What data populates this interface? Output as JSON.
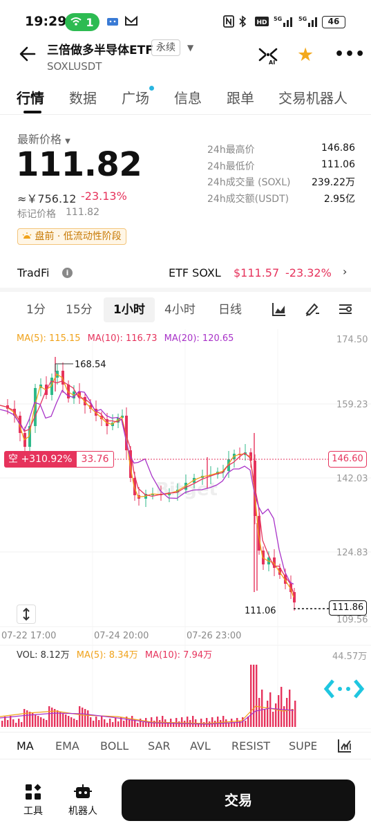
{
  "status_bar": {
    "time": "19:29",
    "wifi_count": "1",
    "network": "5G",
    "battery": "46"
  },
  "header": {
    "title": "三倍做多半导体ETF",
    "badge": "永续",
    "symbol": "SOXLUSDT",
    "ai_label": "AI"
  },
  "main_tabs": [
    {
      "label": "行情"
    },
    {
      "label": "数据"
    },
    {
      "label": "广场"
    },
    {
      "label": "信息"
    },
    {
      "label": "跟单"
    },
    {
      "label": "交易机器人"
    }
  ],
  "price": {
    "label": "最新价格",
    "last": "111.82",
    "cny": "≈￥756.12",
    "change_pct": "-23.13%",
    "mark_label": "标记价格",
    "mark_value": "111.82",
    "stage_badge": "盘前 · 低流动性阶段"
  },
  "stats": [
    {
      "key": "24h最高价",
      "value": "146.86"
    },
    {
      "key": "24h最低价",
      "value": "111.06"
    },
    {
      "key": "24h成交量 (SOXL)",
      "value": "239.22万"
    },
    {
      "key": "24h成交额(USDT)",
      "value": "2.95亿"
    }
  ],
  "tradfi": {
    "label": "TradFi",
    "etf_label": "ETF SOXL",
    "etf_price": "$111.57",
    "etf_change": "-23.32%"
  },
  "intervals": [
    {
      "label": "1分"
    },
    {
      "label": "15分"
    },
    {
      "label": "1小时"
    },
    {
      "label": "4小时"
    },
    {
      "label": "日线"
    }
  ],
  "chart": {
    "ma_legend": {
      "ma5": "MA(5): 115.15",
      "ma10": "MA(10): 116.73",
      "ma20": "MA(20): 120.65"
    },
    "y_ticks": [
      "174.50",
      "159.23",
      "142.03",
      "124.83",
      "109.56"
    ],
    "high_marker": "168.54",
    "low_marker": "111.06",
    "current_price_tag": "111.86",
    "position_side": "空",
    "position_pnl": "+310.92%",
    "position_price": "33.76",
    "position_line_price": "146.60",
    "watermark": "Bitget",
    "time_labels": [
      "07-22 17:00",
      "07-24 20:00",
      "07-26 23:00"
    ],
    "vol_legend": {
      "vol": "VOL: 8.12万",
      "ma5": "MA(5): 8.34万",
      "ma10": "MA(10): 7.94万"
    },
    "vol_max": "44.57万",
    "colors": {
      "up": "#2fb98a",
      "down": "#e6335c",
      "ma5": "#f0a21a",
      "ma10": "#e6335c",
      "ma20": "#a832c8"
    }
  },
  "indicator_tabs": [
    {
      "label": "MA"
    },
    {
      "label": "EMA"
    },
    {
      "label": "BOLL"
    },
    {
      "label": "SAR"
    },
    {
      "label": "AVL"
    },
    {
      "label": "RESIST"
    },
    {
      "label": "SUPE"
    }
  ],
  "bottom_bar": {
    "tools_label": "工具",
    "robot_label": "机器人",
    "trade_label": "交易"
  }
}
